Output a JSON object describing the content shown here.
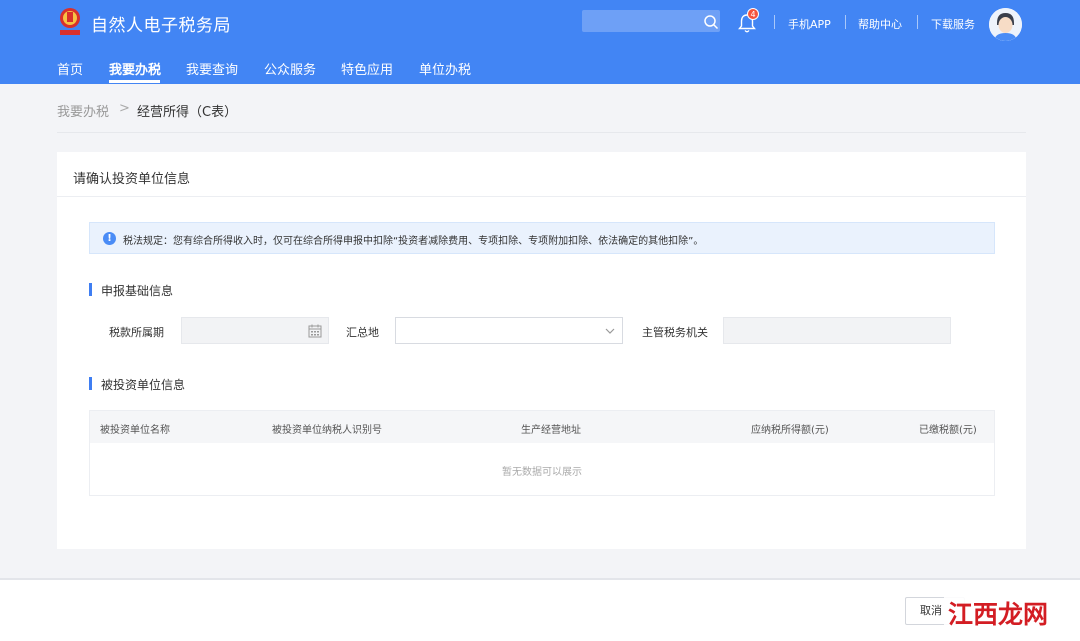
{
  "header": {
    "site_title": "自然人电子税务局",
    "search_placeholder": "",
    "notification_count": "4",
    "links": [
      "手机APP",
      "帮助中心",
      "下载服务"
    ]
  },
  "nav": {
    "items": [
      "首页",
      "我要办税",
      "我要查询",
      "公众服务",
      "特色应用",
      "单位办税"
    ],
    "active": "我要办税"
  },
  "breadcrumb": {
    "parent": "我要办税",
    "separator": ">",
    "current": "经营所得（C表）"
  },
  "card": {
    "title": "请确认投资单位信息",
    "notice": "税法规定：您有综合所得收入时，仅可在综合所得申报中扣除“投资者减除费用、专项扣除、专项附加扣除、依法确定的其他扣除”。",
    "section_basic": "申报基础信息",
    "fields": {
      "period_label": "税款所属期",
      "period_value": "",
      "summary_label": "汇总地",
      "summary_value": "",
      "authority_label": "主管税务机关",
      "authority_value": ""
    },
    "section_invested": "被投资单位信息",
    "table": {
      "columns": [
        "被投资单位名称",
        "被投资单位纳税人识别号",
        "生产经营地址",
        "应纳税所得额(元)",
        "已缴税额(元)"
      ],
      "rows": [],
      "empty_text": "暂无数据可以展示"
    }
  },
  "footer": {
    "cancel_label": "取消",
    "watermark_text": "江西龙网"
  },
  "colors": {
    "header_bg": "#4285f4",
    "accent": "#3f7ef2",
    "badge": "#f5533d",
    "watermark": "#d31d23"
  }
}
